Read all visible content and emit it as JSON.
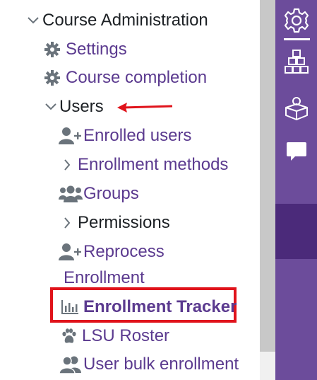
{
  "nav": {
    "course_admin": "Course Administration",
    "settings": "Settings",
    "course_completion": "Course completion",
    "users": "Users",
    "enrolled_users": "Enrolled users",
    "enrollment_methods": "Enrollment methods",
    "groups": "Groups",
    "permissions": "Permissions",
    "reprocess_line1": "Reprocess",
    "reprocess_line2": "Enrollment",
    "enrollment_tracker": "Enrollment Tracker",
    "lsu_roster": "LSU Roster",
    "user_bulk_enrollment": "User bulk enrollment"
  },
  "rail": {
    "icons": [
      "gear-icon",
      "blocks-icon",
      "course-box-icon",
      "chat-icon"
    ]
  },
  "colors": {
    "link": "#5b3a8f",
    "text": "#1d2125",
    "rail": "#6c4c9b",
    "rail_active": "#4b2a7a",
    "annotation_red": "#e0131b"
  }
}
